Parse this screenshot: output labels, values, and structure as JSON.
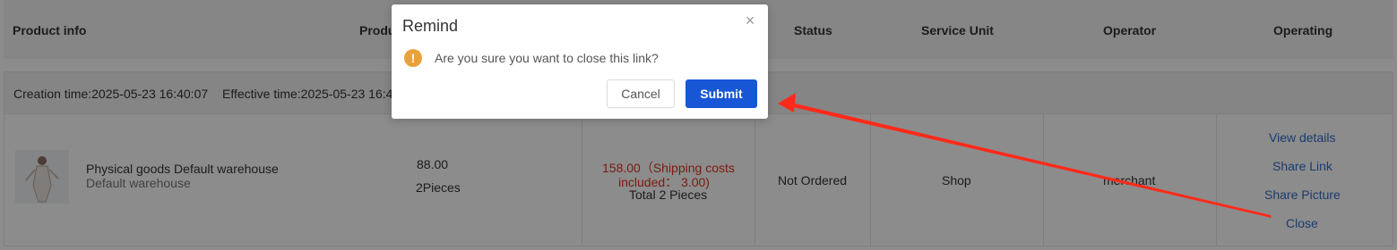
{
  "table": {
    "headers": {
      "product_info": "Product info",
      "product_partial": "Produ",
      "status": "Status",
      "service_unit": "Service Unit",
      "operator": "Operator",
      "operating": "Operating"
    },
    "order": {
      "creation_time": "Creation time:2025-05-23 16:40:07",
      "effective_time": "Effective time:2025-05-23 16:4"
    },
    "row": {
      "product_name": "Physical goods Default warehouse",
      "warehouse": "Default warehouse",
      "price": "88.00",
      "quantity": "2Pieces",
      "total_line1": "158.00（Shipping costs",
      "total_line2": "included： 3.00)",
      "total_pieces": "Total 2 Pieces",
      "status": "Not Ordered",
      "service_unit": "Shop",
      "operator": "merchant",
      "actions": [
        "View details",
        "Share Link",
        "Share Picture",
        "Close"
      ]
    }
  },
  "dialog": {
    "title": "Remind",
    "close_icon": "close-icon",
    "warning_icon": "warning-icon",
    "warning_glyph": "!",
    "close_glyph": "×",
    "message": "Are you sure you want to close this link?",
    "cancel_label": "Cancel",
    "submit_label": "Submit"
  },
  "colors": {
    "accent": "#1757d6",
    "warning": "#e9a23b",
    "price_red": "#e0331f",
    "link_blue": "#2f6ec7",
    "annotation_arrow": "#ff2a1a"
  }
}
